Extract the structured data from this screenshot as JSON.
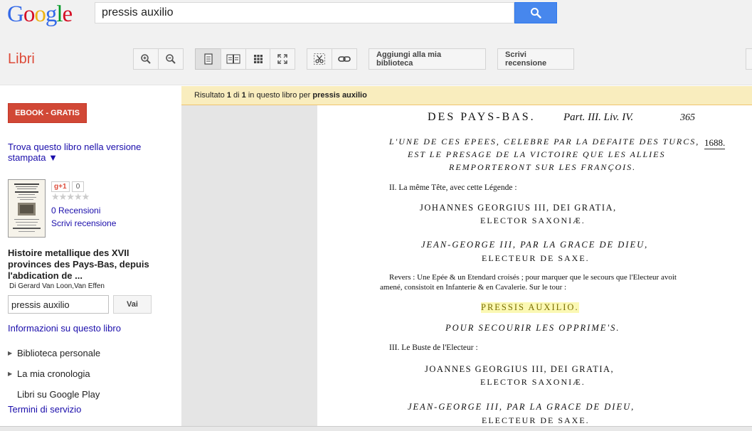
{
  "logo": [
    "G",
    "o",
    "o",
    "g",
    "l",
    "e"
  ],
  "logo_colors": [
    "#3369e8",
    "#d50f25",
    "#eeb211",
    "#3369e8",
    "#009925",
    "#d50f25"
  ],
  "search": {
    "value": "pressis auxilio"
  },
  "section_title": "Libri",
  "toolbar": {
    "add_library": "Aggiungi alla mia biblioteca",
    "write_review": "Scrivi recensione"
  },
  "sidebar": {
    "ebook_button": "EBOOK - GRATIS",
    "print_version_link": "Trova questo libro nella versione stampata ▼",
    "gplus_label": "g+1",
    "gplus_count": "0",
    "stars": "★★★★★",
    "reviews_link": "0 Recensioni",
    "write_review_link": "Scrivi recensione",
    "book_title": "Histoire metallique des XVII provinces des Pays-Bas, depuis l'abdication de ...",
    "book_author": "Di Gerard Van Loon,Van Effen",
    "inbook_search_value": "pressis auxilio",
    "go_button": "Vai",
    "info_link": "Informazioni su questo libro",
    "items": [
      {
        "label": "Biblioteca personale"
      },
      {
        "label": "La mia cronologia"
      },
      {
        "label": "Libri su Google Play"
      }
    ],
    "terms_link": "Termini di servizio"
  },
  "result_bar": {
    "prefix": "Risultato ",
    "current": "1",
    "of": " di ",
    "total": "1",
    "middle": " in questo libro per ",
    "query": "pressis auxilio"
  },
  "page": {
    "header": "DES PAYS-BAS.",
    "header_part": "Part. III. Liv. IV.",
    "page_number": "365",
    "year": "1688.",
    "lines": [
      "L'UNE DE CES EPEES, CELEBRE PAR LA DEFAITE DES TURCS,",
      "EST LE PRESAGE DE LA VICTOIRE QUE LES ALLIES",
      "REMPORTERONT SUR LES FRANÇOIS.",
      "II. La même Tête, avec cette Légende :",
      "JOHANNES GEORGIUS III, DEI GRATIA,",
      "ELECTOR SAXONIÆ.",
      "JEAN-GEORGE III, PAR LA GRACE DE DIEU,",
      "ELECTEUR DE SAXE.",
      "Revers : Une Epée & un Etendard croisés ; pour marquer que le secours que l'Electeur avoit",
      "amené, consistoit en Infanterie & en Cavalerie.  Sur le tour :",
      "PRESSIS AUXILIO.",
      "POUR SECOURIR LES OPPRIME'S.",
      "III. Le Buste de l'Electeur :",
      "JOANNES GEORGIUS III, DEI GRATIA,",
      "ELECTOR SAXONIÆ.",
      "JEAN-GEORGE III, PAR LA GRACE DE DIEU,",
      "ELECTEUR DE SAXE."
    ]
  }
}
